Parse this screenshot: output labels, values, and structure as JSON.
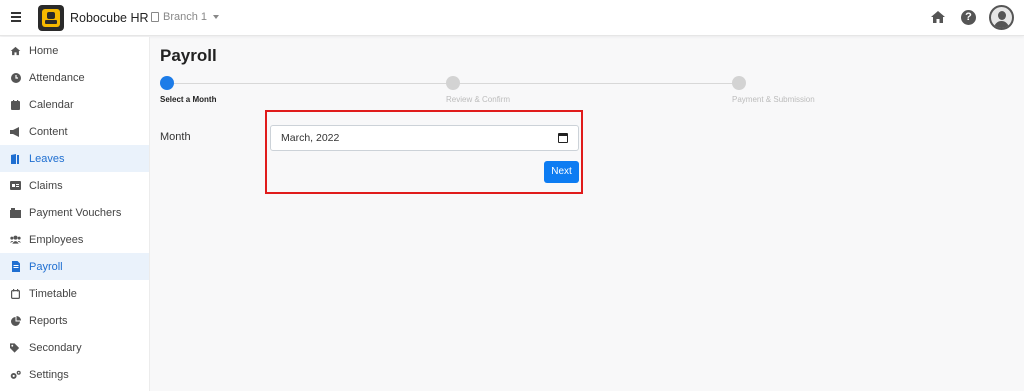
{
  "app": {
    "title": "Robocube HR",
    "branch": "Branch 1"
  },
  "sidebar": {
    "items": [
      {
        "label": "Home",
        "icon": "home-icon"
      },
      {
        "label": "Attendance",
        "icon": "clock-icon"
      },
      {
        "label": "Calendar",
        "icon": "calendar-icon"
      },
      {
        "label": "Content",
        "icon": "megaphone-icon"
      },
      {
        "label": "Leaves",
        "icon": "door-icon"
      },
      {
        "label": "Claims",
        "icon": "id-card-icon"
      },
      {
        "label": "Payment Vouchers",
        "icon": "voucher-icon"
      },
      {
        "label": "Employees",
        "icon": "users-icon"
      },
      {
        "label": "Payroll",
        "icon": "file-invoice-icon"
      },
      {
        "label": "Timetable",
        "icon": "calendar-outline-icon"
      },
      {
        "label": "Reports",
        "icon": "pie-chart-icon"
      },
      {
        "label": "Secondary",
        "icon": "tags-icon"
      },
      {
        "label": "Settings",
        "icon": "cogs-icon"
      }
    ]
  },
  "main": {
    "title": "Payroll",
    "steps": [
      "Select a Month",
      "Review & Confirm",
      "Payment & Submission"
    ],
    "month_label": "Month",
    "month_value": "March, 2022",
    "next_label": "Next"
  },
  "colors": {
    "accent": "#0d7cf2",
    "highlight": "#e01b1b",
    "active_bg": "#eaf2fb"
  }
}
